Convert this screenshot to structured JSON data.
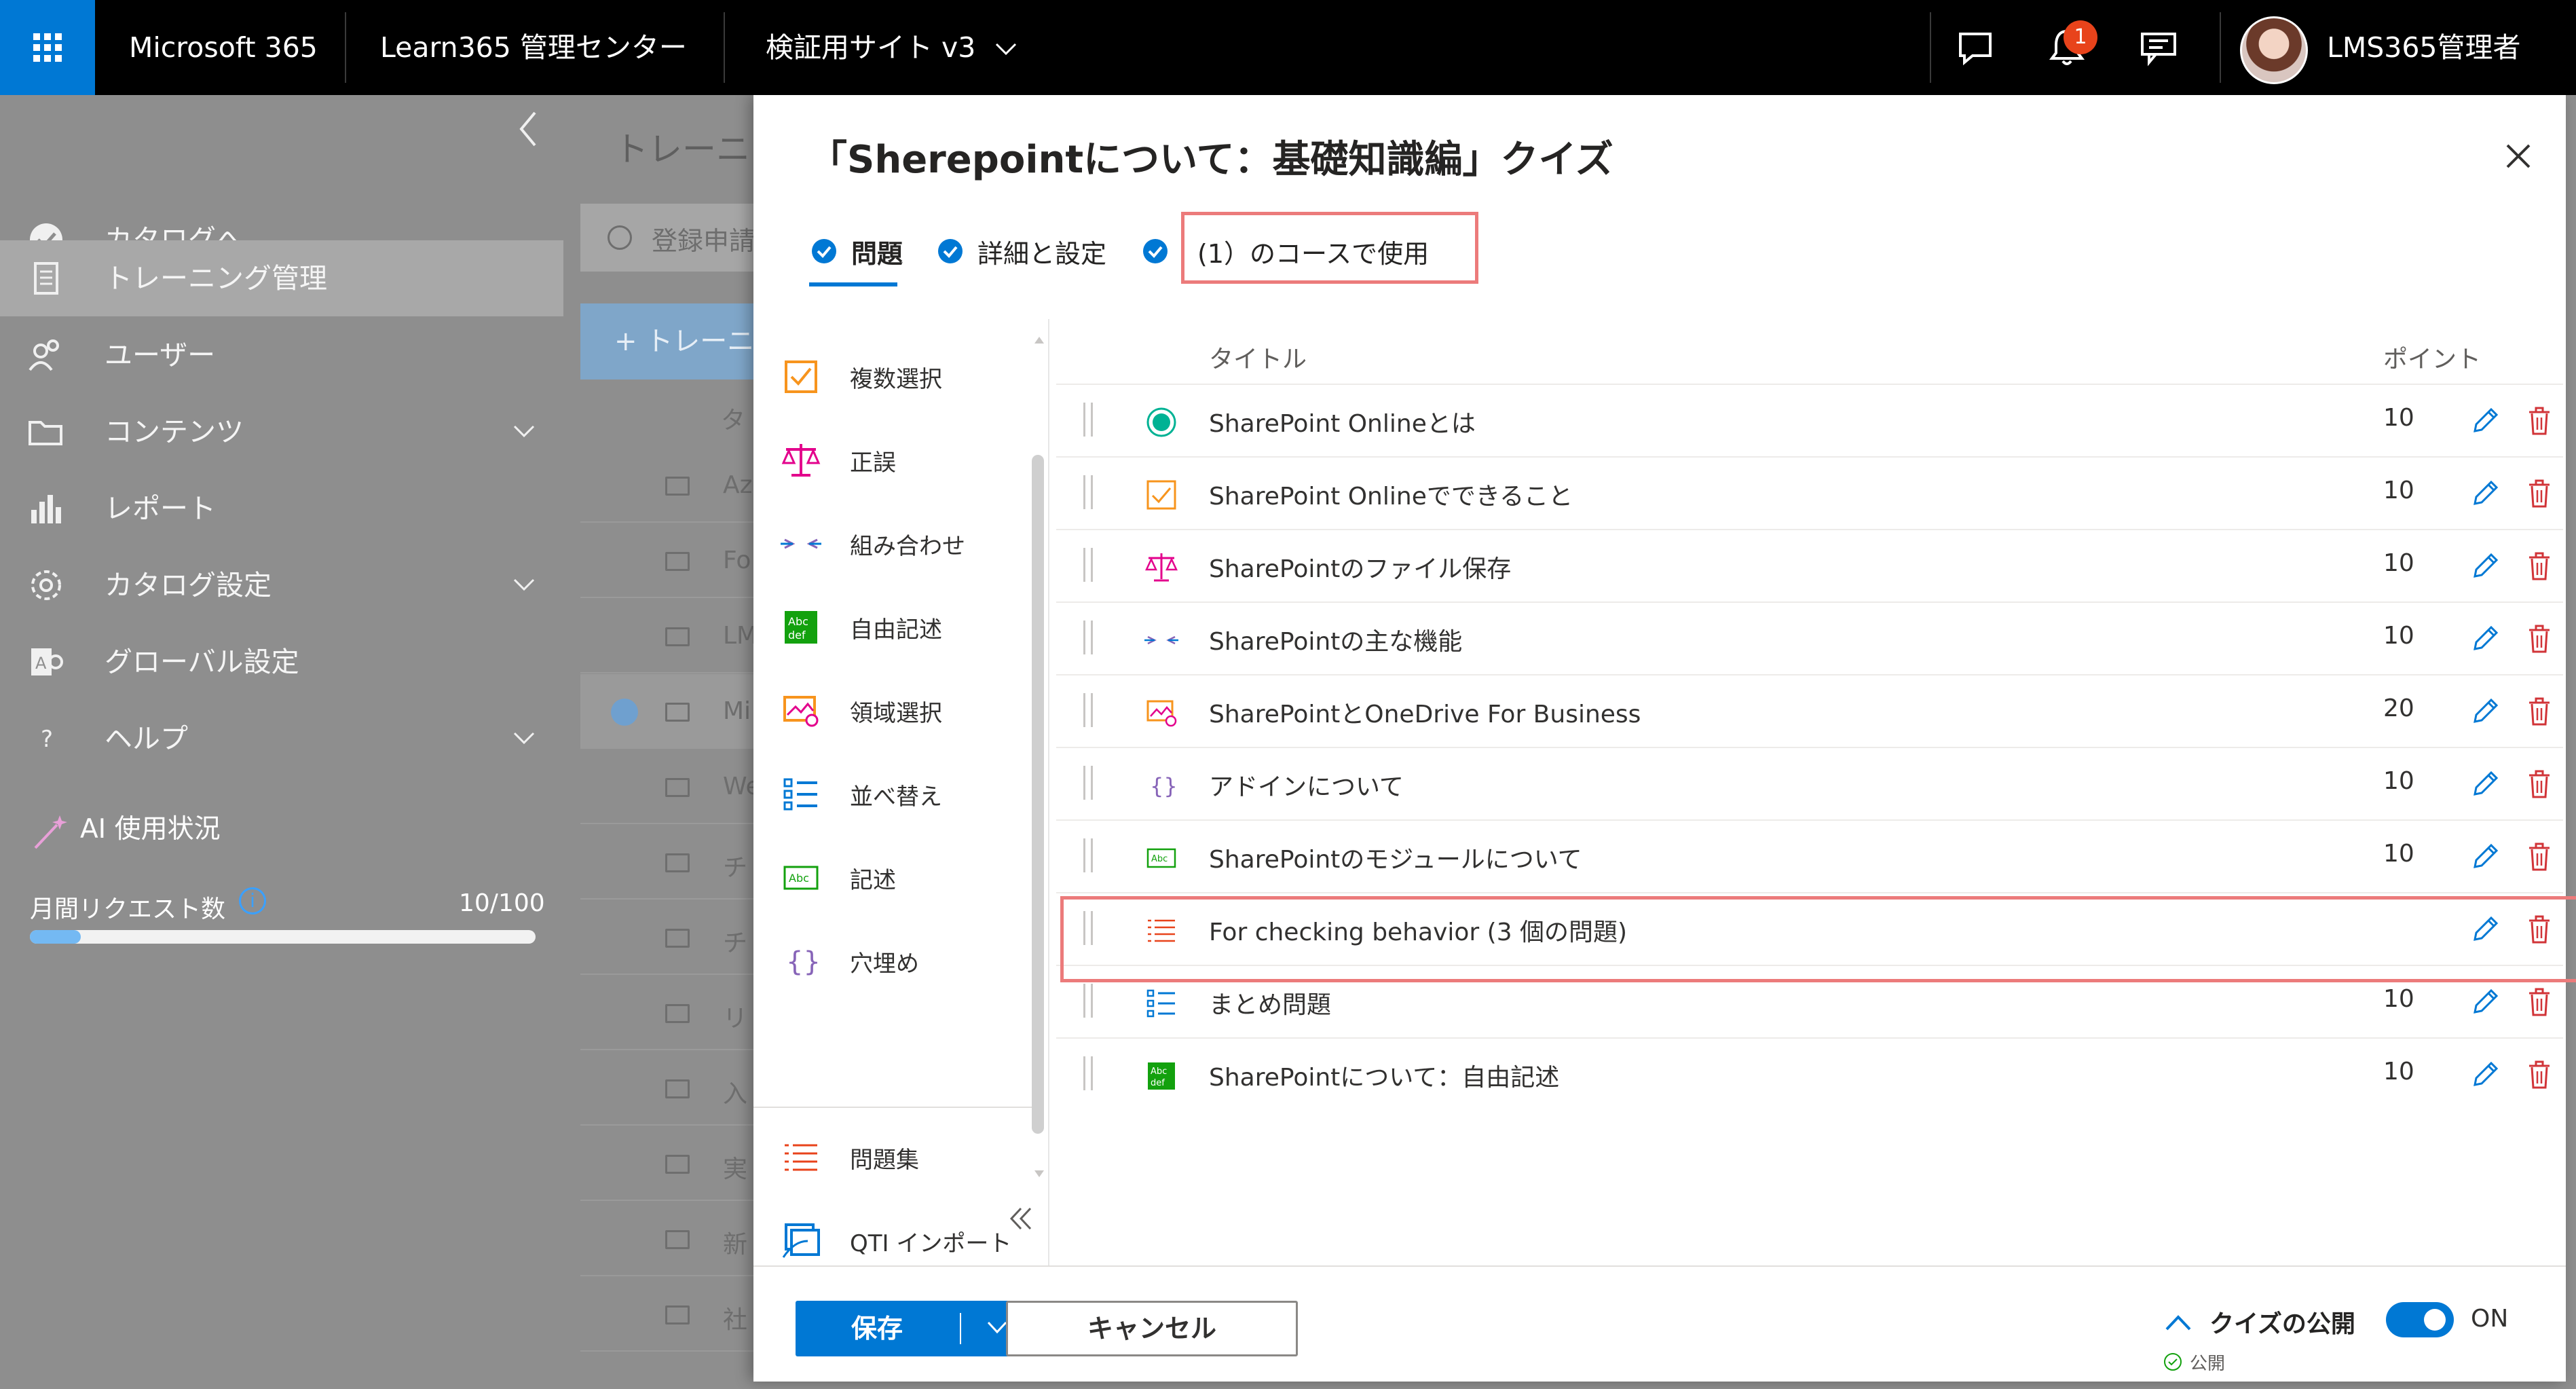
{
  "topbar": {
    "app_name": "Microsoft 365",
    "center_name": "Learn365 管理センター",
    "site_name": "検証用サイト v3",
    "notification_count": "1",
    "user_name": "LMS365管理者"
  },
  "leftnav": {
    "items": [
      {
        "label": "カタログへ",
        "icon": "catalog-check-icon"
      },
      {
        "label": "トレーニング管理",
        "icon": "document-icon"
      },
      {
        "label": "ユーザー",
        "icon": "users-icon"
      },
      {
        "label": "コンテンツ",
        "icon": "folder-icon"
      },
      {
        "label": "レポート",
        "icon": "bar-chart-icon"
      },
      {
        "label": "カタログ設定",
        "icon": "gear-icon"
      },
      {
        "label": "グローバル設定",
        "icon": "global-settings-icon"
      },
      {
        "label": "ヘルプ",
        "icon": "help-icon"
      }
    ],
    "ai_usage_label": "AI 使用状況",
    "monthly_requests_label": "月間リクエスト数",
    "monthly_requests_value": "10/100",
    "monthly_requests_fraction": 0.1
  },
  "background": {
    "title": "トレーニン",
    "card_text": "登録申請",
    "new_button": "+ トレーニ",
    "column_head": "タ",
    "rows": [
      "Az",
      "Fo",
      "LM",
      "Mi",
      "We",
      "チ",
      "チ",
      "リ",
      "入",
      "実",
      "新",
      "社"
    ]
  },
  "panel": {
    "title": "「Sherepointについて：基礎知識編」クイズ",
    "tabs": [
      {
        "label": "問題"
      },
      {
        "label": "詳細と設定"
      },
      {
        "label": "(1）のコースで使用"
      }
    ],
    "question_types": [
      {
        "label": "複数選択",
        "icon": "multiple-choice-icon"
      },
      {
        "label": "正誤",
        "icon": "scale-icon"
      },
      {
        "label": "組み合わせ",
        "icon": "matching-arrows-icon"
      },
      {
        "label": "自由記述",
        "icon": "abc-def-icon"
      },
      {
        "label": "領域選択",
        "icon": "hotspot-icon"
      },
      {
        "label": "並べ替え",
        "icon": "ordering-list-icon"
      },
      {
        "label": "記述",
        "icon": "abc-icon"
      },
      {
        "label": "穴埋め",
        "icon": "curly-braces-icon"
      },
      {
        "label": "問題集",
        "icon": "question-pool-icon"
      },
      {
        "label": "QTI インポート",
        "icon": "import-icon"
      }
    ],
    "table": {
      "col_title": "タイトル",
      "col_points": "ポイント",
      "rows": [
        {
          "title": "SharePoint Onlineとは",
          "points": "10",
          "icon": "single-choice-icon"
        },
        {
          "title": "SharePoint Onlineでできること",
          "points": "10",
          "icon": "multiple-choice-icon"
        },
        {
          "title": "SharePointのファイル保存",
          "points": "10",
          "icon": "scale-icon"
        },
        {
          "title": "SharePointの主な機能",
          "points": "10",
          "icon": "matching-arrows-icon"
        },
        {
          "title": "SharePointとOneDrive For Business",
          "points": "20",
          "icon": "hotspot-icon"
        },
        {
          "title": "アドインについて",
          "points": "10",
          "icon": "curly-braces-icon"
        },
        {
          "title": "SharePointのモジュールについて",
          "points": "10",
          "icon": "abc-icon"
        },
        {
          "title": "For checking behavior (3 個の問題)",
          "points": "",
          "icon": "question-pool-icon"
        },
        {
          "title": "まとめ問題",
          "points": "10",
          "icon": "ordering-list-icon"
        },
        {
          "title": "SharePointについて：自由記述",
          "points": "10",
          "icon": "abc-def-icon"
        }
      ]
    },
    "footer": {
      "save_label": "保存",
      "cancel_label": "キャンセル",
      "publish_label": "クイズの公開",
      "publish_status": "公開",
      "toggle_label": "ON"
    }
  },
  "colors": {
    "accent": "#0078d4",
    "highlight_border": "#ec7b7b",
    "delete_red": "#d13438",
    "orange": "#f7941d",
    "pink": "#e3008c",
    "green": "#13a10e",
    "teal": "#00b294",
    "purple": "#8764b8"
  }
}
